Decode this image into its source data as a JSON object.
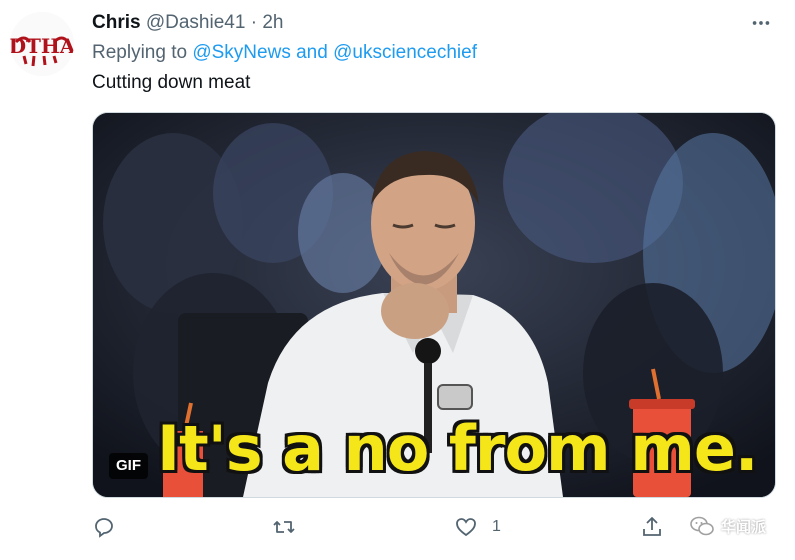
{
  "tweet": {
    "display_name": "Chris",
    "handle": "@Dashie41",
    "separator": "·",
    "time": "2h",
    "replying_prefix": "Replying to",
    "mention_1": "@SkyNews",
    "conjunction": "and",
    "mention_2": "@uksciencechief",
    "text": "Cutting down meat",
    "avatar_text": "DTHA"
  },
  "media": {
    "caption": "It's a no from me.",
    "badge": "GIF"
  },
  "actions": {
    "reply_icon": "reply-icon",
    "retweet_icon": "retweet-icon",
    "like_icon": "like-icon",
    "like_count": "1",
    "share_icon": "share-icon"
  },
  "watermark": {
    "text": "华闻派",
    "icon": "wechat-icon"
  },
  "colors": {
    "link": "#1d9bf0",
    "secondary_text": "#536471",
    "caption_yellow": "#f5e61a"
  }
}
